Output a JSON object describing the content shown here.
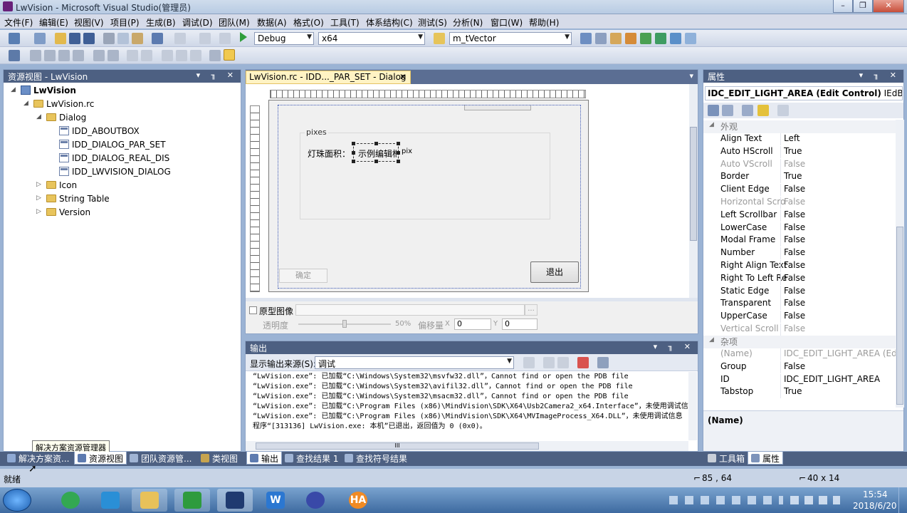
{
  "window": {
    "title": "LwVision - Microsoft Visual Studio(管理员)",
    "controls": [
      "–",
      "❐",
      "✕"
    ]
  },
  "menu": [
    "文件(F)",
    "编辑(E)",
    "视图(V)",
    "项目(P)",
    "生成(B)",
    "调试(D)",
    "团队(M)",
    "数据(A)",
    "格式(O)",
    "工具(T)",
    "体系结构(C)",
    "测试(S)",
    "分析(N)",
    "窗口(W)",
    "帮助(H)"
  ],
  "toolbar": {
    "config": "Debug",
    "platform": "x64",
    "find": "m_tVector",
    "start_icon": "play-icon"
  },
  "resource_view": {
    "title": "资源视图 - LwVision",
    "pin_buttons": "▾ ╖ ✕",
    "tree": {
      "project": "LwVision",
      "rc": "LwVision.rc",
      "dialog_folder": "Dialog",
      "dialogs": [
        "IDD_ABOUTBOX",
        "IDD_DIALOG_PAR_SET",
        "IDD_DIALOG_REAL_DIS",
        "IDD_LWVISION_DIALOG"
      ],
      "other_folders": [
        "Icon",
        "String Table",
        "Version"
      ]
    },
    "tooltip": "解决方案资源管理器"
  },
  "editor": {
    "tab_title": "LwVision.rc - IDD..._PAR_SET - Dialog",
    "tab_close": "✕",
    "group_label": "pixes",
    "field_label": "灯珠面积：",
    "edit_text": "示例编辑框",
    "unit_text": "pix",
    "ok_button": "确定",
    "exit_button": "退出",
    "prototype_label": "原型图像",
    "opacity_label": "透明度",
    "opacity_value": "50%",
    "offset_label": "偏移量",
    "offset_x_label": "X",
    "offset_x": "0",
    "offset_y_label": "Y",
    "offset_y": "0",
    "browse_button": "..."
  },
  "properties": {
    "title": "属性",
    "selected_object": "IDC_EDIT_LIGHT_AREA (Edit Control)",
    "selected_type": "IEdBoxE",
    "cat_appearance": "外观",
    "cat_misc": "杂项",
    "rows_appearance": [
      {
        "name": "Align Text",
        "value": "Left",
        "disabled": false
      },
      {
        "name": "Auto HScroll",
        "value": "True",
        "disabled": false
      },
      {
        "name": "Auto VScroll",
        "value": "False",
        "disabled": true
      },
      {
        "name": "Border",
        "value": "True",
        "disabled": false
      },
      {
        "name": "Client Edge",
        "value": "False",
        "disabled": false
      },
      {
        "name": "Horizontal Scro",
        "value": "False",
        "disabled": true
      },
      {
        "name": "Left Scrollbar",
        "value": "False",
        "disabled": false
      },
      {
        "name": "LowerCase",
        "value": "False",
        "disabled": false
      },
      {
        "name": "Modal Frame",
        "value": "False",
        "disabled": false
      },
      {
        "name": "Number",
        "value": "False",
        "disabled": false
      },
      {
        "name": "Right Align Text",
        "value": "False",
        "disabled": false
      },
      {
        "name": "Right To Left Re",
        "value": "False",
        "disabled": false
      },
      {
        "name": "Static Edge",
        "value": "False",
        "disabled": false
      },
      {
        "name": "Transparent",
        "value": "False",
        "disabled": false
      },
      {
        "name": "UpperCase",
        "value": "False",
        "disabled": false
      },
      {
        "name": "Vertical Scroll",
        "value": "False",
        "disabled": true
      }
    ],
    "rows_misc": [
      {
        "name": "(Name)",
        "value": "IDC_EDIT_LIGHT_AREA (Edit",
        "disabled": true
      },
      {
        "name": "Group",
        "value": "False",
        "disabled": false
      },
      {
        "name": "ID",
        "value": "IDC_EDIT_LIGHT_AREA",
        "disabled": false
      },
      {
        "name": "Tabstop",
        "value": "True",
        "disabled": false
      }
    ],
    "description_title": "(Name)"
  },
  "output": {
    "title": "输出",
    "source_label": "显示输出来源(S):",
    "source_value": "调试",
    "lines": [
      "“LwVision.exe”: 已加载“C:\\Windows\\System32\\msvfw32.dll”，Cannot find or open the PDB file",
      "“LwVision.exe”: 已加载“C:\\Windows\\System32\\avifil32.dll”，Cannot find or open the PDB file",
      "“LwVision.exe”: 已加载“C:\\Windows\\System32\\msacm32.dll”，Cannot find or open the PDB file",
      "“LwVision.exe”: 已加载“C:\\Program Files (x86)\\MindVision\\SDK\\X64\\Usb2Camera2_x64.Interface”，未使用调试信",
      "“LwVision.exe”: 已加载“C:\\Program Files (x86)\\MindVision\\SDK\\X64\\MVImageProcess_X64.DLL”，未使用调试信息",
      "程序“[313136] LwVision.exe: 本机”已退出，返回值为 0 (0x0)。"
    ],
    "hscroll_mark": "III"
  },
  "bottom_tabs_left": [
    "解决方案资...",
    "资源视图",
    "团队资源管...",
    "类视图"
  ],
  "bottom_tabs_center": [
    "输出",
    "查找结果 1",
    "查找符号结果"
  ],
  "bottom_tabs_right": [
    "工具箱",
    "属性"
  ],
  "status": {
    "text": "就绪",
    "position": "85 , 64",
    "size": "40 x 14"
  },
  "taskbar": {
    "time": "15:54",
    "date": "2018/6/20",
    "apps": [
      "windows-start-icon",
      "360-browser-icon",
      "camera-app-icon",
      "file-explorer-icon",
      "green-app-icon",
      "visual-studio-icon",
      "wps-writer-icon",
      "infinity-app-icon",
      "halcon-icon"
    ],
    "ha_label": "HA",
    "w_label": "W"
  }
}
